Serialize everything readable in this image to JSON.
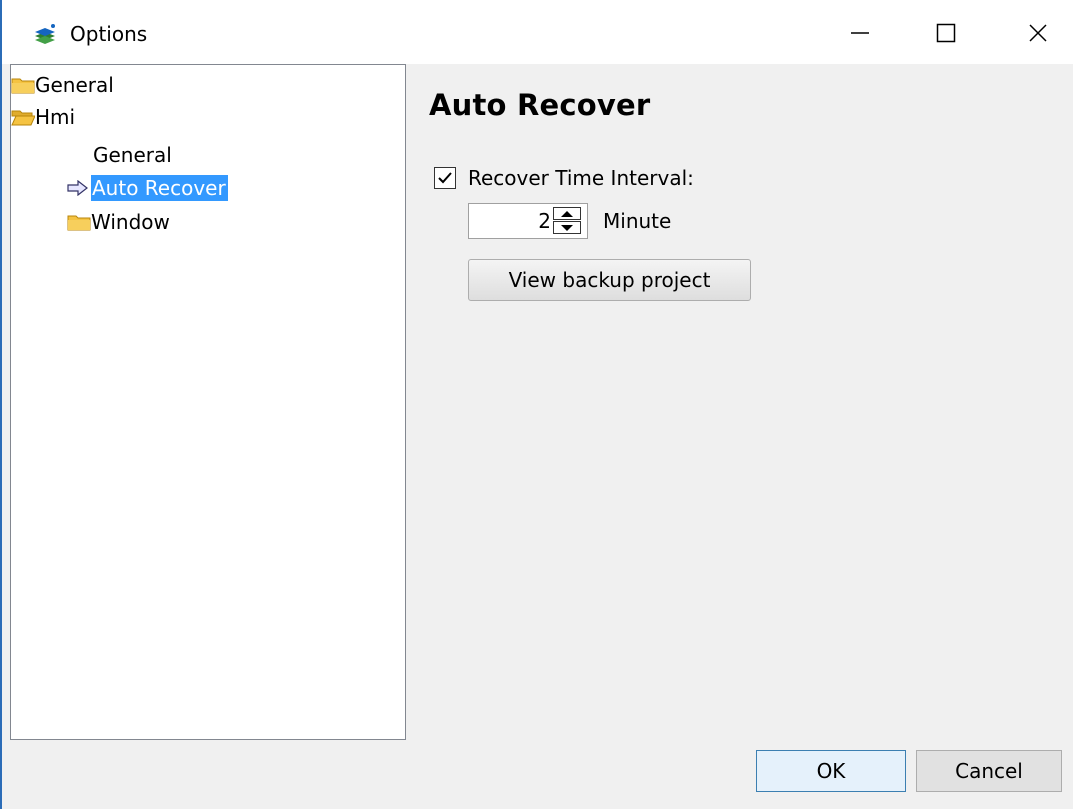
{
  "window": {
    "title": "Options",
    "controls": {
      "minimize": "minimize-icon",
      "maximize": "maximize-icon",
      "close": "close-icon"
    }
  },
  "tree": {
    "items": [
      {
        "label": "General",
        "icon": "folder-closed-icon",
        "level": 0
      },
      {
        "label": "Hmi",
        "icon": "folder-open-icon",
        "level": 0
      },
      {
        "label": "General",
        "icon": "",
        "level": 1
      },
      {
        "label": "Auto Recover",
        "icon": "arrow-right-icon",
        "level": 1,
        "selected": true
      },
      {
        "label": "Window",
        "icon": "folder-closed-icon",
        "level": 0
      }
    ]
  },
  "page": {
    "heading": "Auto Recover",
    "recover_checkbox": {
      "label": "Recover Time Interval:",
      "checked": true
    },
    "interval": {
      "value": "2",
      "unit": "Minute"
    },
    "backup_button": "View backup project"
  },
  "footer": {
    "ok_label": "OK",
    "cancel_label": "Cancel"
  },
  "colors": {
    "selection": "#3399ff",
    "folder": "#f5c342",
    "window_border": "#2b6cb7"
  }
}
